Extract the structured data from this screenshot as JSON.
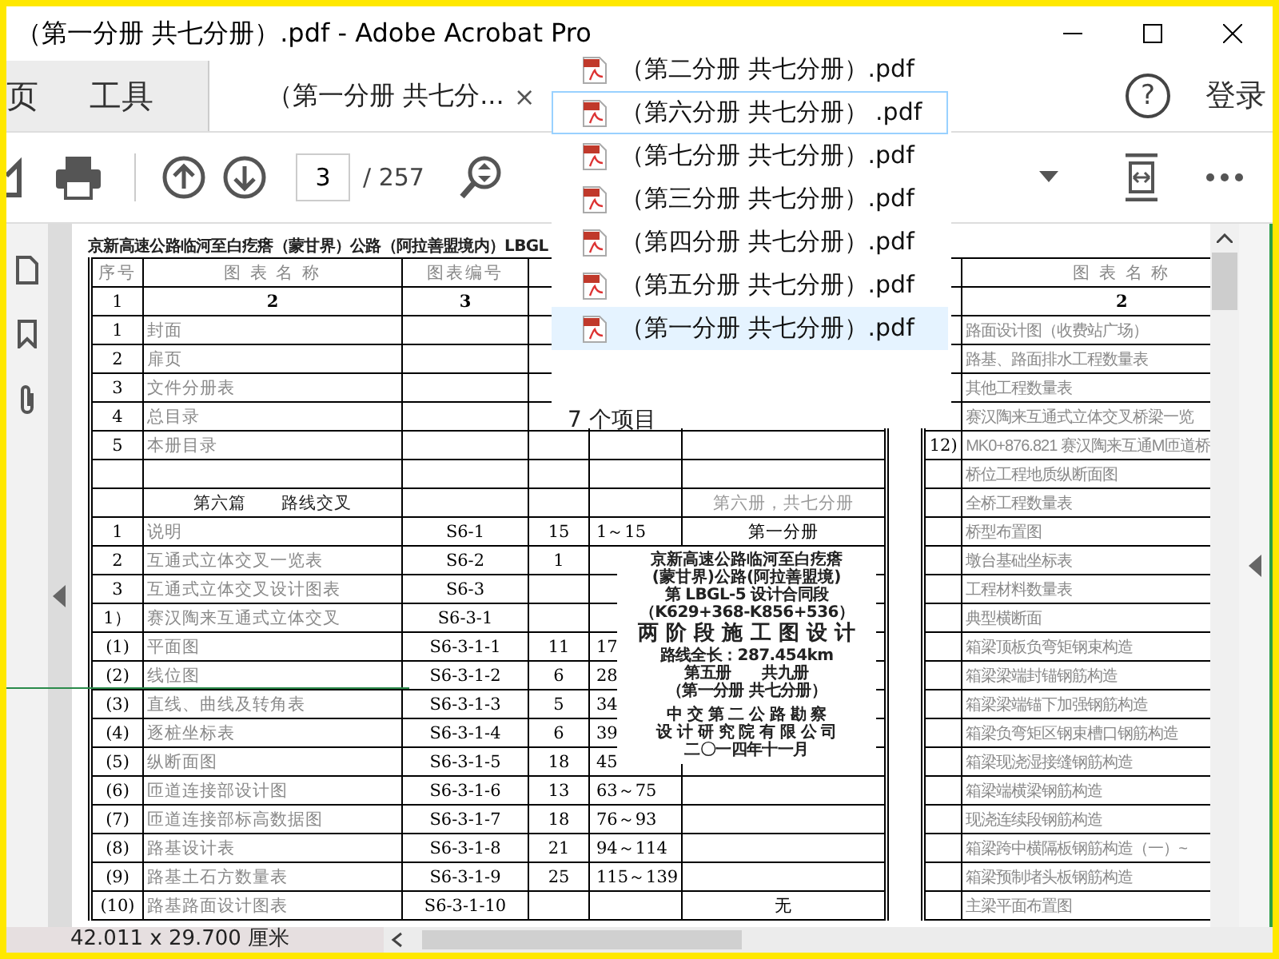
{
  "window": {
    "title": "（第一分册 共七分册）.pdf - Adobe Acrobat Pro"
  },
  "tabs": [
    {
      "label": "页",
      "kind": "nav",
      "selected": false
    },
    {
      "label": "工具",
      "kind": "nav",
      "selected": false
    },
    {
      "label": "（第一分册 共七分...",
      "kind": "document",
      "selected": true,
      "close": "×"
    }
  ],
  "header_right": {
    "help": "?",
    "login": "登录"
  },
  "toolbar": {
    "page_value": "3",
    "page_total": "/ 257"
  },
  "document": {
    "heading": "京新高速公路临河至白疙瘩（蒙甘界）公路（阿拉善盟境内）LBGL",
    "left_table": {
      "columns": [
        "序号",
        "图 表 名 称",
        "图表编号"
      ],
      "rows": [
        {
          "kind": "index",
          "serial": "1",
          "name": "2",
          "code": "3"
        },
        {
          "kind": "item",
          "serial": "1",
          "name": "封面"
        },
        {
          "kind": "item",
          "serial": "2",
          "name": "扉页"
        },
        {
          "kind": "item",
          "serial": "3",
          "name": "文件分册表"
        },
        {
          "kind": "item",
          "serial": "4",
          "name": "总目录"
        },
        {
          "kind": "item",
          "serial": "5",
          "name": "本册目录"
        },
        {
          "kind": "item"
        },
        {
          "kind": "section",
          "name": "第六篇　　路线交叉",
          "remark": "第六册，共七分册"
        },
        {
          "kind": "item",
          "serial": "1",
          "name": "说明",
          "code": "S6-1",
          "qty": "15",
          "pages": "1～15",
          "remark": "第一分册"
        },
        {
          "kind": "item",
          "serial": "2",
          "name": "互通式立体交叉一览表",
          "code": "S6-2",
          "qty": "1"
        },
        {
          "kind": "item",
          "serial": "3",
          "name": "互通式立体交叉设计图表",
          "code": "S6-3"
        },
        {
          "kind": "item",
          "serial": "1）",
          "name": "赛汉陶来互通式立体交叉",
          "code": "S6-3-1"
        },
        {
          "kind": "item",
          "serial": "(1)",
          "name": "平面图",
          "code": "S6-3-1-1",
          "qty": "11",
          "pages": "17"
        },
        {
          "kind": "item",
          "serial": "(2)",
          "name": "线位图",
          "code": "S6-3-1-2",
          "qty": "6",
          "pages": "28"
        },
        {
          "kind": "item",
          "serial": "(3)",
          "name": "直线、曲线及转角表",
          "code": "S6-3-1-3",
          "qty": "5",
          "pages": "34"
        },
        {
          "kind": "item",
          "serial": "(4)",
          "name": "逐桩坐标表",
          "code": "S6-3-1-4",
          "qty": "6",
          "pages": "39"
        },
        {
          "kind": "item",
          "serial": "(5)",
          "name": "纵断面图",
          "code": "S6-3-1-5",
          "qty": "18",
          "pages": "45"
        },
        {
          "kind": "item",
          "serial": "(6)",
          "name": "匝道连接部设计图",
          "code": "S6-3-1-6",
          "qty": "13",
          "pages": "63～75"
        },
        {
          "kind": "item",
          "serial": "(7)",
          "name": "匝道连接部标高数据图",
          "code": "S6-3-1-7",
          "qty": "18",
          "pages": "76～93"
        },
        {
          "kind": "item",
          "serial": "(8)",
          "name": "路基设计表",
          "code": "S6-3-1-8",
          "qty": "21",
          "pages": "94～114"
        },
        {
          "kind": "item",
          "serial": "(9)",
          "name": "路基土石方数量表",
          "code": "S6-3-1-9",
          "qty": "25",
          "pages": "115～139"
        },
        {
          "kind": "item",
          "serial": "(10)",
          "name": "路基路面设计图表",
          "code": "S6-3-1-10",
          "remark": "无"
        }
      ]
    },
    "right_table": {
      "columns": [
        "图 表 名 称"
      ],
      "rows": [
        {
          "kind": "index",
          "name": "2"
        },
        {
          "kind": "item",
          "name": "路面设计图（收费站广场）"
        },
        {
          "kind": "item",
          "name": "路基、路面排水工程数量表"
        },
        {
          "kind": "item",
          "name": "其他工程数量表"
        },
        {
          "kind": "item",
          "name": "赛汉陶来互通式立体交叉桥梁一览"
        },
        {
          "kind": "item",
          "serial": "12)",
          "name": "MK0+876.821 赛汉陶来互通M匝道桥"
        },
        {
          "kind": "item",
          "name": "桥位工程地质纵断面图"
        },
        {
          "kind": "item",
          "name": "全桥工程数量表"
        },
        {
          "kind": "item",
          "name": "桥型布置图"
        },
        {
          "kind": "item",
          "name": "墩台基础坐标表"
        },
        {
          "kind": "item",
          "name": "工程材料数量表"
        },
        {
          "kind": "item",
          "name": "典型横断面"
        },
        {
          "kind": "item",
          "name": "箱梁顶板负弯矩钢束构造"
        },
        {
          "kind": "item",
          "name": "箱梁梁端封锚钢筋构造"
        },
        {
          "kind": "item",
          "name": "箱梁梁端锚下加强钢筋构造"
        },
        {
          "kind": "item",
          "name": "箱梁负弯矩区钢束槽口钢筋构造"
        },
        {
          "kind": "item",
          "name": "箱梁现浇湿接缝钢筋构造"
        },
        {
          "kind": "item",
          "name": "箱梁端横梁钢筋构造"
        },
        {
          "kind": "item",
          "name": "现浇连续段钢筋构造"
        },
        {
          "kind": "item",
          "name": "箱梁跨中横隔板钢筋构造（一）~"
        },
        {
          "kind": "item",
          "name": "箱梁预制堵头板钢筋构造"
        },
        {
          "kind": "item",
          "name": "主梁平面布置图"
        }
      ]
    },
    "cover": {
      "lines": [
        {
          "kind": "title",
          "text": "京新高速公路临河至白疙瘩"
        },
        {
          "kind": "title",
          "text": "(蒙甘界)公路(阿拉善盟境)"
        },
        {
          "kind": "line",
          "text": "第 LBGL-5 设计合同段"
        },
        {
          "kind": "line",
          "text": "（K629+368-K856+536）"
        },
        {
          "kind": "heading",
          "text": "两 阶 段 施 工 图 设 计"
        },
        {
          "kind": "line",
          "text": "路线全长：287.454km"
        },
        {
          "kind": "line",
          "text": "第五册　　共九册"
        },
        {
          "kind": "line",
          "text": "（第一分册 共七分册）"
        },
        {
          "kind": "company",
          "text": "中 交 第 二 公 路 勘 察"
        },
        {
          "kind": "line",
          "text": "设 计 研 究 院 有 限 公 司"
        },
        {
          "kind": "line",
          "text": "二〇一四年十一月"
        }
      ]
    }
  },
  "file_popup": {
    "items": [
      {
        "name": "（第二分册 共七分册）.pdf",
        "focused": false,
        "selected": false
      },
      {
        "name": "（第六分册 共七分册） .pdf",
        "focused": true,
        "selected": false
      },
      {
        "name": "（第七分册 共七分册）.pdf",
        "focused": false,
        "selected": false
      },
      {
        "name": "（第三分册 共七分册）.pdf",
        "focused": false,
        "selected": false
      },
      {
        "name": "（第四分册 共七分册）.pdf",
        "focused": false,
        "selected": false
      },
      {
        "name": "（第五分册 共七分册）.pdf",
        "focused": false,
        "selected": false
      },
      {
        "name": "（第一分册 共七分册）.pdf",
        "focused": false,
        "selected": true
      }
    ],
    "count": "7 个项目"
  },
  "status_bar": {
    "page_size": "42.011 x 29.700 厘米"
  }
}
